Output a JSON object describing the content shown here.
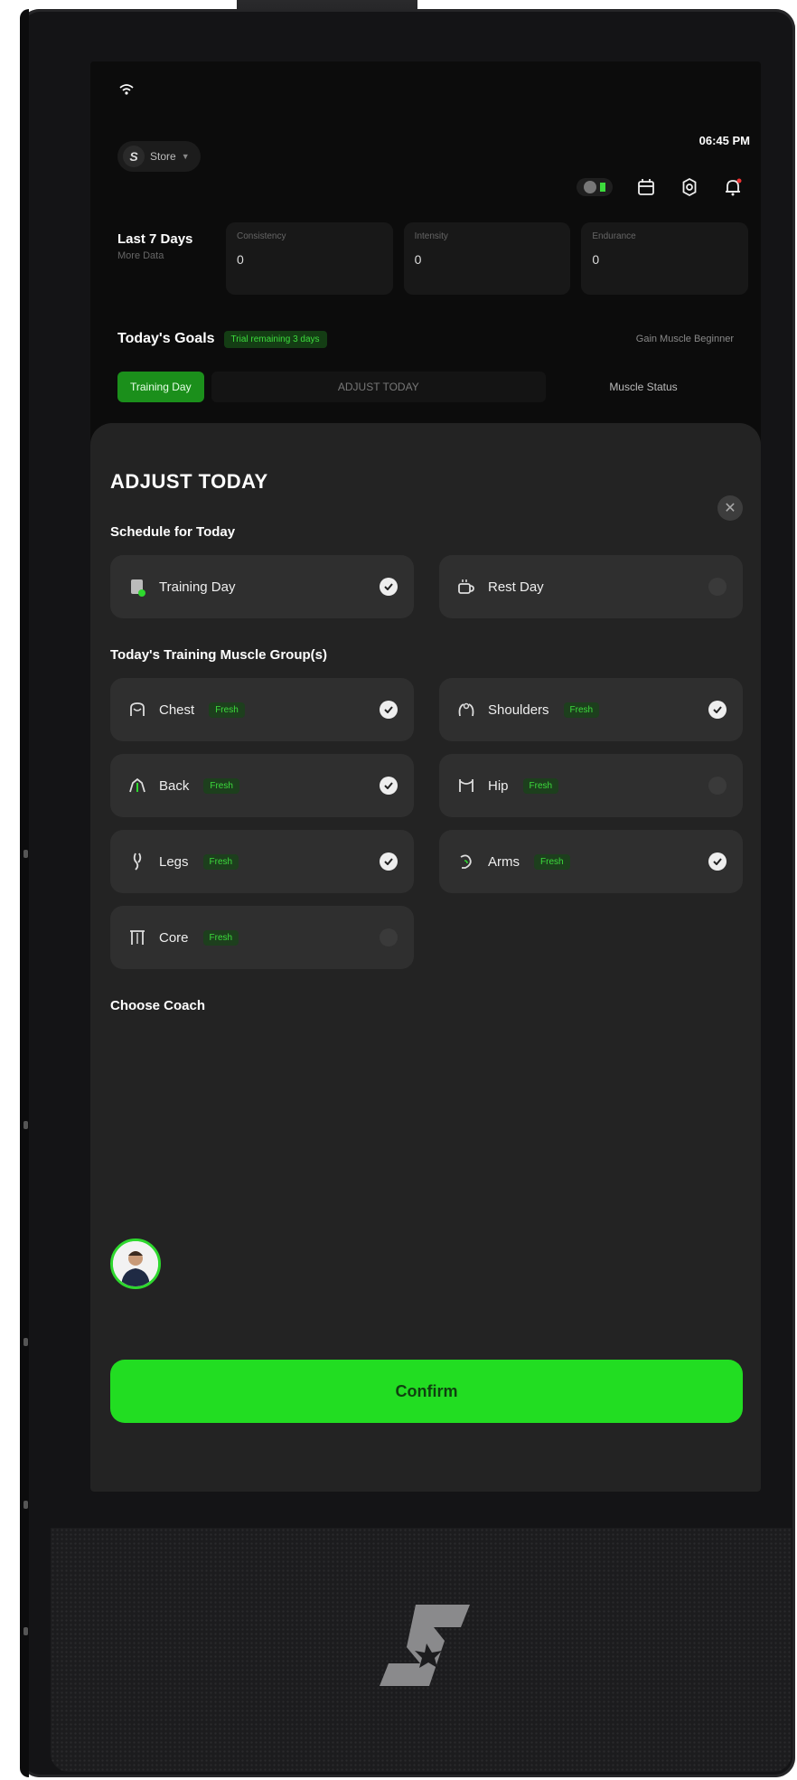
{
  "status": {
    "time": "06:45 PM"
  },
  "store": {
    "label": "Store"
  },
  "stats": {
    "title": "Last 7 Days",
    "subtitle": "More Data",
    "cards": [
      {
        "label": "Consistency",
        "value": "0"
      },
      {
        "label": "Intensity",
        "value": "0"
      },
      {
        "label": "Endurance",
        "value": "0"
      }
    ]
  },
  "goals": {
    "title": "Today's Goals",
    "tag": "Trial remaining 3 days",
    "mode": "Gain Muscle Beginner"
  },
  "tabs": {
    "active": "Training Day",
    "adjust": "ADJUST TODAY",
    "muscle": "Muscle Status"
  },
  "modal": {
    "title": "ADJUST TODAY",
    "schedule_heading": "Schedule for Today",
    "schedule": [
      {
        "label": "Training Day",
        "selected": true
      },
      {
        "label": "Rest Day",
        "selected": false
      }
    ],
    "muscle_heading": "Today's Training Muscle Group(s)",
    "fresh_label": "Fresh",
    "muscles": [
      {
        "label": "Chest",
        "selected": true
      },
      {
        "label": "Shoulders",
        "selected": true
      },
      {
        "label": "Back",
        "selected": true
      },
      {
        "label": "Hip",
        "selected": false
      },
      {
        "label": "Legs",
        "selected": true
      },
      {
        "label": "Arms",
        "selected": true
      },
      {
        "label": "Core",
        "selected": false
      }
    ],
    "coach_heading": "Choose Coach",
    "confirm_label": "Confirm"
  },
  "colors": {
    "accent": "#22dd22",
    "panel": "#232323",
    "card": "#2f2f2f"
  }
}
